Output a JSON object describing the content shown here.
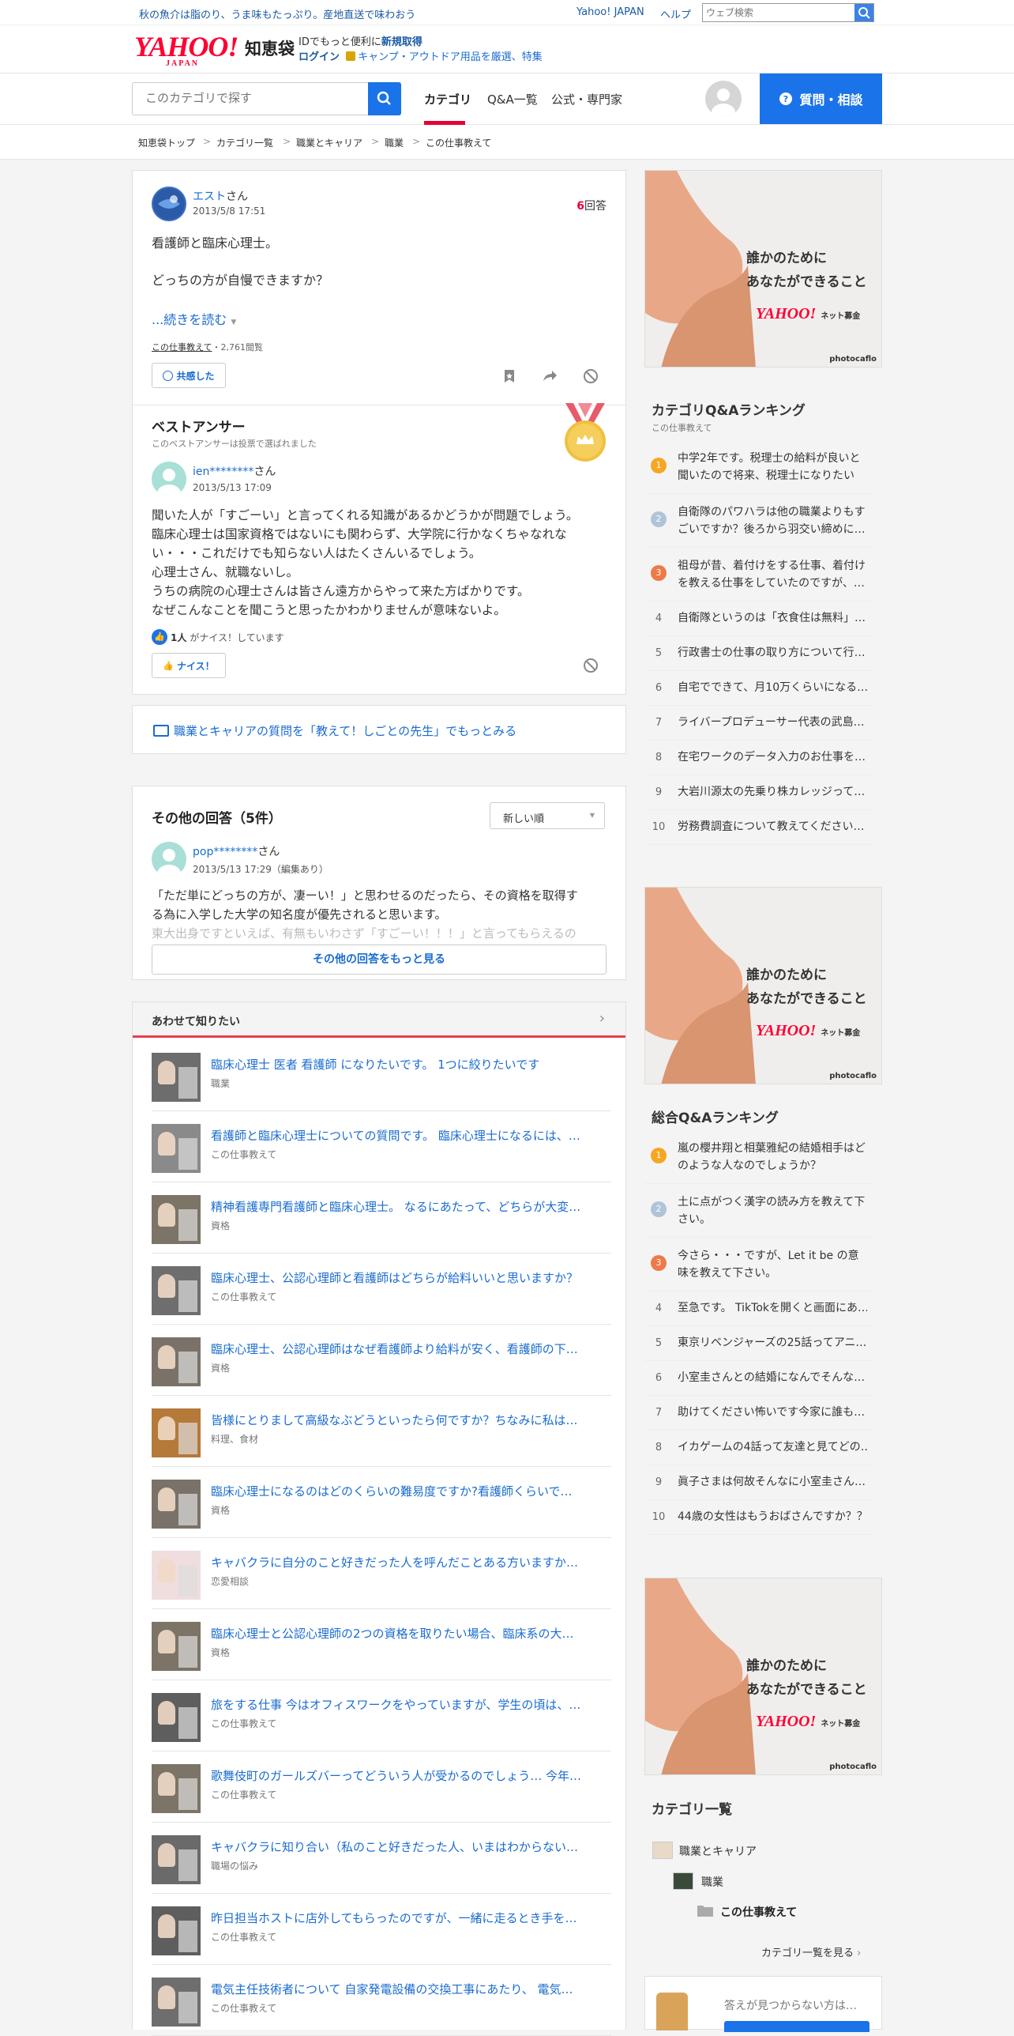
{
  "topbar": {
    "promo": "秋の魚介は脂のり、うま味もたっぷり。産地直送で味わおう",
    "yahoo_japan": "Yahoo! JAPAN",
    "help": "ヘルプ",
    "search_placeholder": "ウェブ検索"
  },
  "logo": {
    "main": "YAHOO!",
    "sub": "JAPAN",
    "service": "知恵袋"
  },
  "id_promo": {
    "line1_a": "IDでもっと便利に",
    "line1_b": "新規取得",
    "login": "ログイン",
    "line2": "キャンプ・アウトドア用品を厳選、特集"
  },
  "nav": {
    "search_placeholder": "このカテゴリで探す",
    "tabs": [
      "カテゴリ",
      "Q&A一覧",
      "公式・専門家"
    ],
    "ask_button": "質問・相談"
  },
  "breadcrumbs": [
    "知恵袋トップ",
    "カテゴリ一覧",
    "職業とキャリア",
    "職業",
    "この仕事教えて"
  ],
  "question": {
    "user": "エスト",
    "san": "さん",
    "date": "2013/5/8 17:51",
    "answers_count": "6",
    "answers_label": "回答",
    "body1": "看護師と臨床心理士。",
    "body2": "どっちの方が自慢できますか？",
    "read_more": "...続きを読む",
    "category": "この仕事教えて",
    "views": "・2,761閲覧",
    "empathy": "共感した"
  },
  "best_answer": {
    "heading": "ベストアンサー",
    "sub": "このベストアンサーは投票で選ばれました",
    "user": "ien********",
    "san": "さん",
    "date": "2013/5/13 17:09",
    "lines": [
      "聞いた人が「すごーい」と言ってくれる知識があるかどうかが問題でしょう。",
      "臨床心理士は国家資格ではないにも関わらず、大学院に行かなくちゃなれな",
      "い・・・これだけでも知らない人はたくさんいるでしょう。",
      "心理士さん、就職ないし。",
      "うちの病院の心理士さんは皆さん遠方からやって来た方ばかりです。",
      "なぜこんなことを聞こうと思ったかわかりませんが意味ないよ。"
    ],
    "nice_count": "1人",
    "nice_text": "がナイス！しています",
    "nice_button": "ナイス！"
  },
  "teacher_link": "職業とキャリアの質問を「教えて！しごとの先生」でもっとみる",
  "other_answers": {
    "heading": "その他の回答（5件）",
    "sort": "新しい順",
    "user": "pop********",
    "san": "さん",
    "date": "2013/5/13 17:29（編集あり）",
    "line1": "「ただ単にどっちの方が、凄ーい！」と思わせるのだったら、その資格を取得す",
    "line2": "る為に入学した大学の知名度が優先されると思います。",
    "line3": "東大出身ですといえば、有無もいわさず「すごーい！！！」と言ってもらえるの",
    "more": "その他の回答をもっと見る"
  },
  "related": {
    "heading": "あわせて知りたい",
    "items": [
      {
        "title": "臨床心理士 医者 看護師 になりたいです。 1つに絞りたいです",
        "cat": "職業"
      },
      {
        "title": "看護師と臨床心理士についての質問です。 臨床心理士になるには、…",
        "cat": "この仕事教えて"
      },
      {
        "title": "精神看護専門看護師と臨床心理士。 なるにあたって、どちらが大変…",
        "cat": "資格"
      },
      {
        "title": "臨床心理士、公認心理師と看護師はどちらが給料いいと思いますか？",
        "cat": "この仕事教えて"
      },
      {
        "title": "臨床心理士、公認心理師はなぜ看護師より給料が安く、看護師の下…",
        "cat": "資格"
      },
      {
        "title": "皆様にとりまして高級なぶどうといったら何ですか？ちなみに私は…",
        "cat": "料理、食材"
      },
      {
        "title": "臨床心理士になるのはどのくらいの難易度ですか?看護師くらいで…",
        "cat": "資格"
      },
      {
        "title": "キャバクラに自分のこと好きだった人を呼んだことある方いますか…",
        "cat": "恋愛相談"
      },
      {
        "title": "臨床心理士と公認心理師の2つの資格を取りたい場合、臨床系の大…",
        "cat": "資格"
      },
      {
        "title": "旅をする仕事 今はオフィスワークをやっていますが、学生の頃は、…",
        "cat": "この仕事教えて"
      },
      {
        "title": "歌舞伎町のガールズバーってどういう人が受かるのでしょう… 今年…",
        "cat": "この仕事教えて"
      },
      {
        "title": "キャバクラに知り合い（私のこと好きだった人、いまはわからない…",
        "cat": "職場の悩み"
      },
      {
        "title": "昨日担当ホストに店外してもらったのですが、一緒に走るとき手を…",
        "cat": "この仕事教えて"
      },
      {
        "title": "電気主任技術者について 自家発電設備の交換工事にあたり、 電気…",
        "cat": "この仕事教えて"
      }
    ]
  },
  "ad": {
    "line1": "誰かのために",
    "line2": "あなたができること",
    "brand": "YAHOO!",
    "brand_sub": "ネット募金",
    "credit": "photocaflo"
  },
  "cat_ranking": {
    "heading": "カテゴリQ&Aランキング",
    "sub": "この仕事教えて",
    "items": [
      "中学2年です。税理士の給料が良いと聞いたので将来、税理士になりたいの…",
      "自衛隊のパワハラは他の職業よりもすごいですか？後ろから羽交い締めに…",
      "祖母が昔、着付けをする仕事、着付けを教える仕事をしていたのですが、…",
      "自衛隊というのは「衣食住は無料」…",
      "行政書士の仕事の取り方について行…",
      "自宅でできて、月10万くらいになる…",
      "ライバープロデューサー代表の武島…",
      "在宅ワークのデータ入力のお仕事を…",
      "大岩川源太の先乗り株カレッジって…",
      "労務費調査について教えてください…"
    ]
  },
  "overall_ranking": {
    "heading": "総合Q&Aランキング",
    "items": [
      "嵐の櫻井翔と相葉雅紀の結婚相手はどのような人なのでしょうか？",
      "土に点がつく漢字の読み方を教えて下さい。",
      "今さら・・・ですが、Let it be の意味を教えて下さい。",
      "至急です。 TikTokを開くと画面にあ…",
      "東京リベンジャーズの25話ってアニ…",
      "小室圭さんとの結婚になんでそんな…",
      "助けてください怖いです今家に誰も…",
      "イカゲームの4話って友達と見てどの…",
      "眞子さまは何故そんなに小室圭さん…",
      "44歳の女性はもうおばさんですか？？…"
    ]
  },
  "category_list": {
    "heading": "カテゴリ一覧",
    "level1": "職業とキャリア",
    "level2": "職業",
    "level3": "この仕事教えて",
    "see_all": "カテゴリ一覧を見る"
  },
  "bottom_box": {
    "text": "答えが見つからない方は…"
  },
  "colors": {
    "accent_blue": "#1a73e8",
    "red": "#e60033",
    "rank1": "#f5a623",
    "rank2": "#b0c4d8",
    "rank3": "#ee7a4a"
  }
}
